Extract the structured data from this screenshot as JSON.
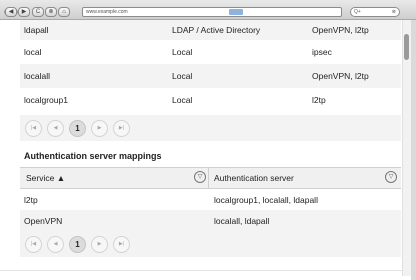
{
  "browser": {
    "url": "www.example.com",
    "search_placeholder": "Q+",
    "nav_back": "◀",
    "nav_forward": "▶",
    "nav_reload": "C",
    "nav_stop": "⊗",
    "nav_home": "⌂"
  },
  "auth_servers": {
    "rows": [
      {
        "name": "ldapall",
        "type": "LDAP / Active Directory",
        "services": "OpenVPN, l2tp"
      },
      {
        "name": "local",
        "type": "Local",
        "services": "ipsec"
      },
      {
        "name": "localall",
        "type": "Local",
        "services": "OpenVPN, l2tp"
      },
      {
        "name": "localgroup1",
        "type": "Local",
        "services": "l2tp"
      }
    ],
    "pager": {
      "first": "|◀",
      "prev": "◀",
      "page": "1",
      "next": "▶",
      "last": "▶|"
    }
  },
  "mappings": {
    "title": "Authentication server mappings",
    "columns": {
      "service": "Service ▲",
      "auth_server": "Authentication server"
    },
    "filter_icon": "▽",
    "rows": [
      {
        "service": "l2tp",
        "servers": "localgroup1, localall, ldapall"
      },
      {
        "service": "OpenVPN",
        "servers": "localall, ldapall"
      }
    ],
    "pager": {
      "first": "|◀",
      "prev": "◀",
      "page": "1",
      "next": "▶",
      "last": "▶|"
    }
  }
}
